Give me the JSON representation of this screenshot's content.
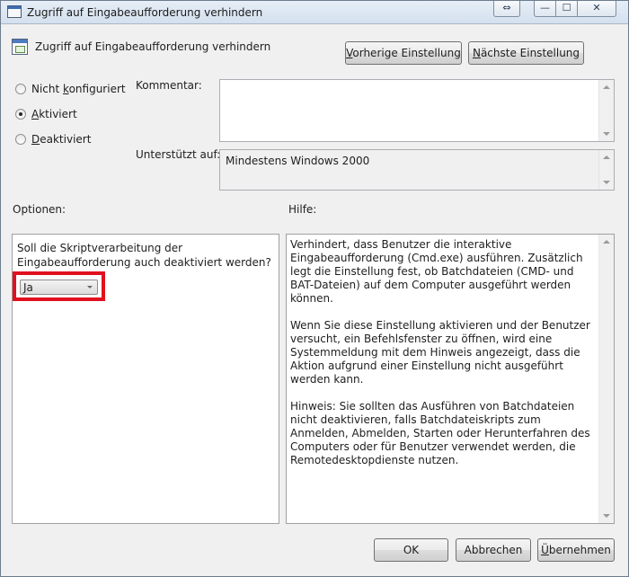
{
  "window": {
    "title": "Zugriff auf Eingabeaufforderung verhindern",
    "controls": {
      "resize": "⇔",
      "minimize": "—",
      "maximize": "☐",
      "close": "✕"
    }
  },
  "header": {
    "title": "Zugriff auf Eingabeaufforderung verhindern",
    "prev_button": "Vorherige Einstellung",
    "next_button": "Nächste Einstellung"
  },
  "state": {
    "options": [
      {
        "label": "Nicht konfiguriert",
        "checked": false
      },
      {
        "label": "Aktiviert",
        "checked": true
      },
      {
        "label": "Deaktiviert",
        "checked": false
      }
    ]
  },
  "comment": {
    "label": "Kommentar:",
    "value": ""
  },
  "supported": {
    "label": "Unterstützt auf:",
    "value": "Mindestens Windows 2000"
  },
  "options": {
    "label": "Optionen:",
    "question": "Soll die Skriptverarbeitung der Eingabeaufforderung auch deaktiviert werden?",
    "dropdown_value": "Ja"
  },
  "help": {
    "label": "Hilfe:",
    "paragraphs": [
      "Verhindert, dass Benutzer die interaktive Eingabeaufforderung (Cmd.exe) ausführen. Zusätzlich legt die Einstellung fest, ob Batchdateien (CMD- und BAT-Dateien) auf dem Computer ausgeführt werden können.",
      "Wenn Sie diese Einstellung aktivieren und der Benutzer versucht, ein Befehlsfenster zu öffnen, wird eine Systemmeldung mit dem Hinweis angezeigt, dass die Aktion aufgrund einer Einstellung nicht ausgeführt werden kann.",
      "Hinweis: Sie sollten das Ausführen von Batchdateien nicht deaktivieren, falls Batchdateiskripts zum Anmelden, Abmelden, Starten oder Herunterfahren des Computers oder für Benutzer verwendet werden, die Remotedesktopdienste nutzen."
    ]
  },
  "footer": {
    "ok": "OK",
    "cancel": "Abbrechen",
    "apply": "Übernehmen"
  },
  "colors": {
    "highlight": "#e0101e",
    "window_bg": "#f0f0f0"
  },
  "icons": {
    "window": "policy-window-icon",
    "header": "policy-setting-icon"
  }
}
